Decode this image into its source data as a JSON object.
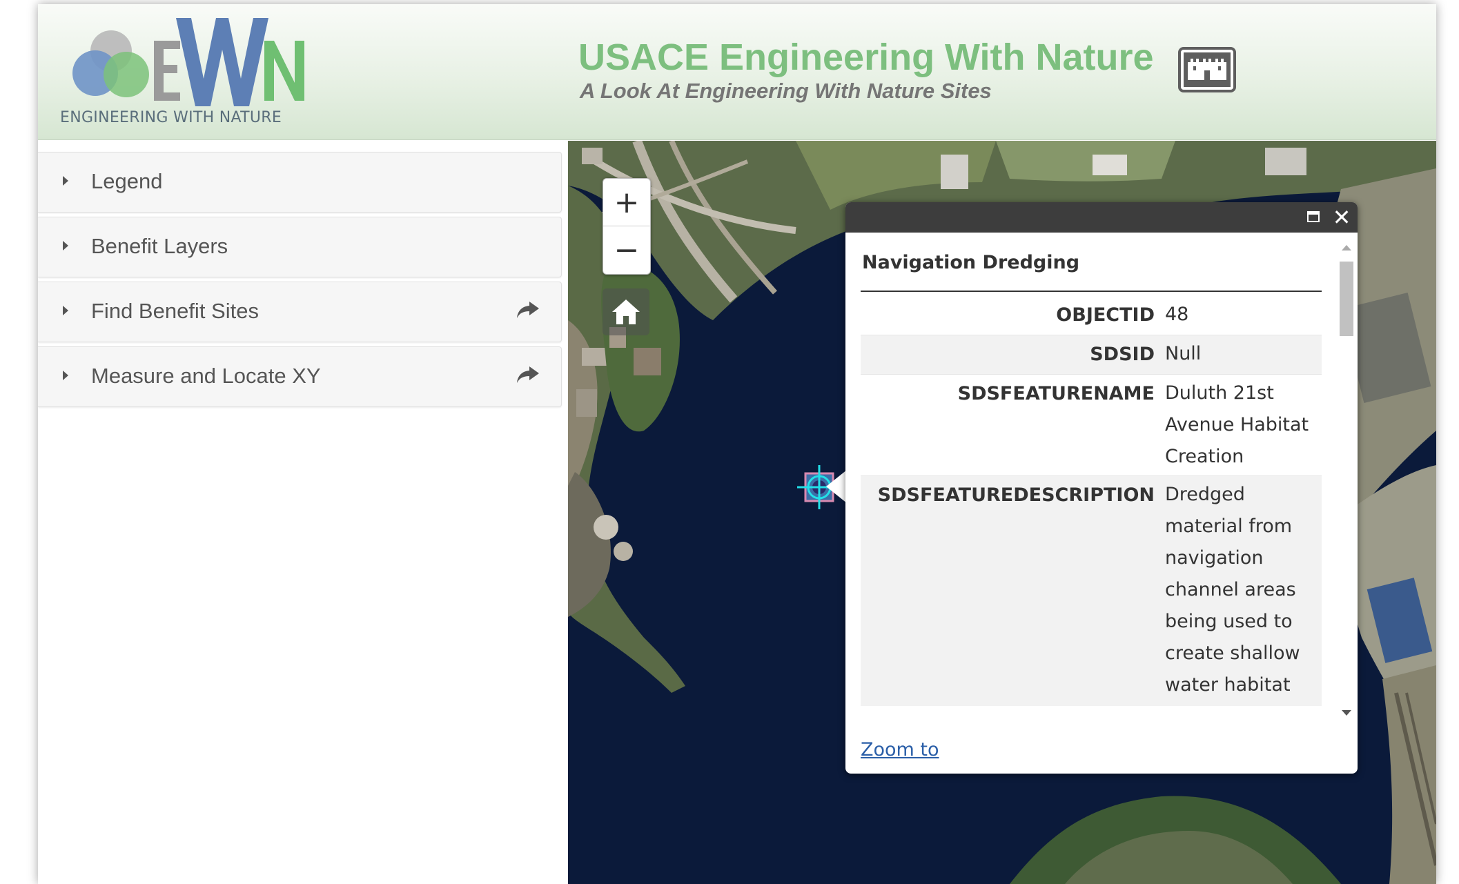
{
  "header": {
    "logo_caption": "ENGINEERING WITH NATURE",
    "title": "USACE Engineering With Nature",
    "subtitle": "A Look At Engineering With Nature Sites"
  },
  "sidebar": {
    "panels": [
      {
        "label": "Legend",
        "has_share": false
      },
      {
        "label": "Benefit Layers",
        "has_share": false
      },
      {
        "label": "Find Benefit Sites",
        "has_share": true
      },
      {
        "label": "Measure and Locate XY",
        "has_share": true
      }
    ]
  },
  "map": {
    "zoom_in": "+",
    "zoom_out": "−",
    "icons": [
      "plus-icon",
      "minus-icon",
      "home-icon",
      "share-icon",
      "castle-icon",
      "maximize-icon",
      "close-icon"
    ]
  },
  "popup": {
    "title": "Navigation Dredging",
    "close": "✕",
    "rows": [
      {
        "key": "OBJECTID",
        "value": "48"
      },
      {
        "key": "SDSID",
        "value": "Null"
      },
      {
        "key": "SDSFEATURENAME",
        "value": "Duluth 21st Avenue Habitat Creation"
      },
      {
        "key": "SDSFEATUREDESCRIPTION",
        "value": "Dredged material from navigation channel areas being used to create shallow water habitat for submerged"
      }
    ],
    "zoom_link": "Zoom to"
  },
  "colors": {
    "title_green": "#7dbf7f",
    "subtitle_gray": "#757575",
    "water": "#0b1a3a",
    "popup_titlebar": "#3d3d3d",
    "link_blue": "#2b5fa8"
  }
}
